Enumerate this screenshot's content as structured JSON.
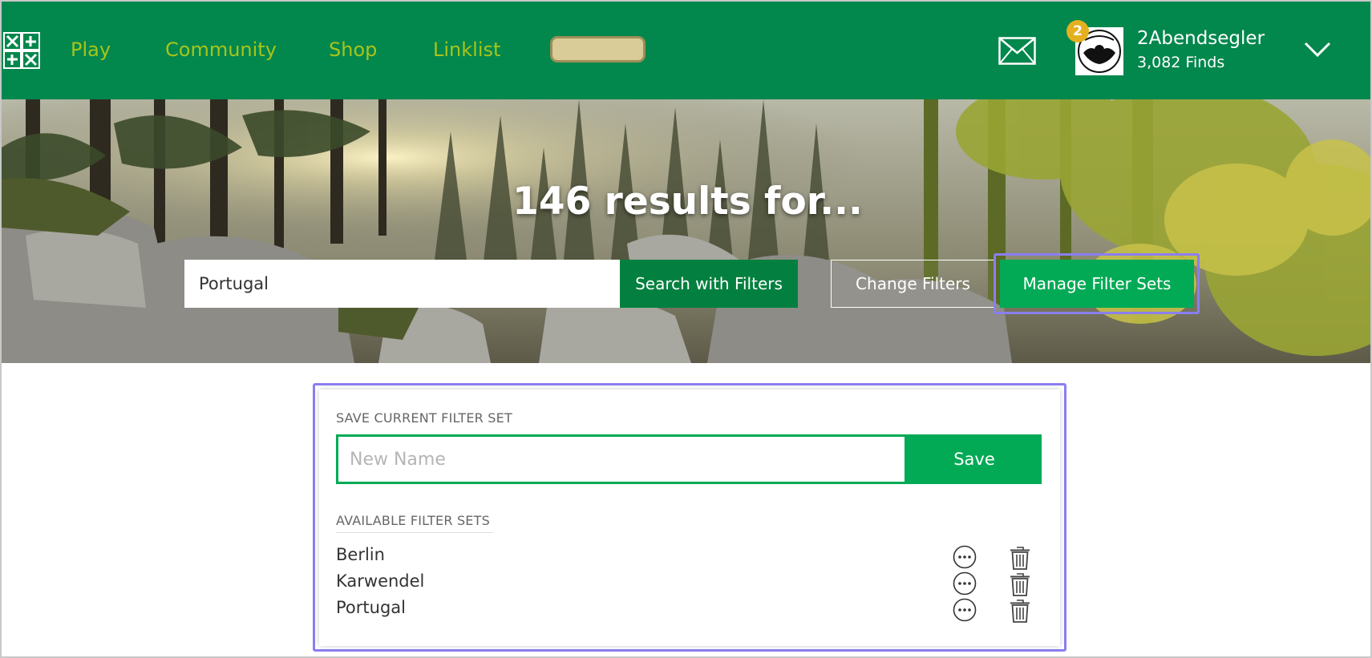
{
  "nav": {
    "links": [
      "Play",
      "Community",
      "Shop",
      "Linklist"
    ],
    "message_icon": "mail-icon",
    "menu_icon": "chevron-down-icon"
  },
  "user": {
    "notification_count": "2",
    "name": "2Abendsegler",
    "finds": "3,082 Finds",
    "avatar_text": "2Abendsegler"
  },
  "hero": {
    "title": "146 results for...",
    "search_value": "Portugal",
    "search_button": "Search with Filters",
    "change_filters_button": "Change Filters",
    "manage_button": "Manage Filter Sets"
  },
  "filter_panel": {
    "save_heading": "SAVE CURRENT FILTER SET",
    "name_placeholder": "New Name",
    "save_button": "Save",
    "available_heading": "AVAILABLE FILTER SETS",
    "sets": [
      "Berlin",
      "Karwendel",
      "Portugal"
    ]
  },
  "colors": {
    "nav_bg": "#02874d",
    "nav_link": "#a8c41a",
    "primary": "#02aa55",
    "highlight": "#8b7ef0",
    "badge": "#e5b020"
  }
}
